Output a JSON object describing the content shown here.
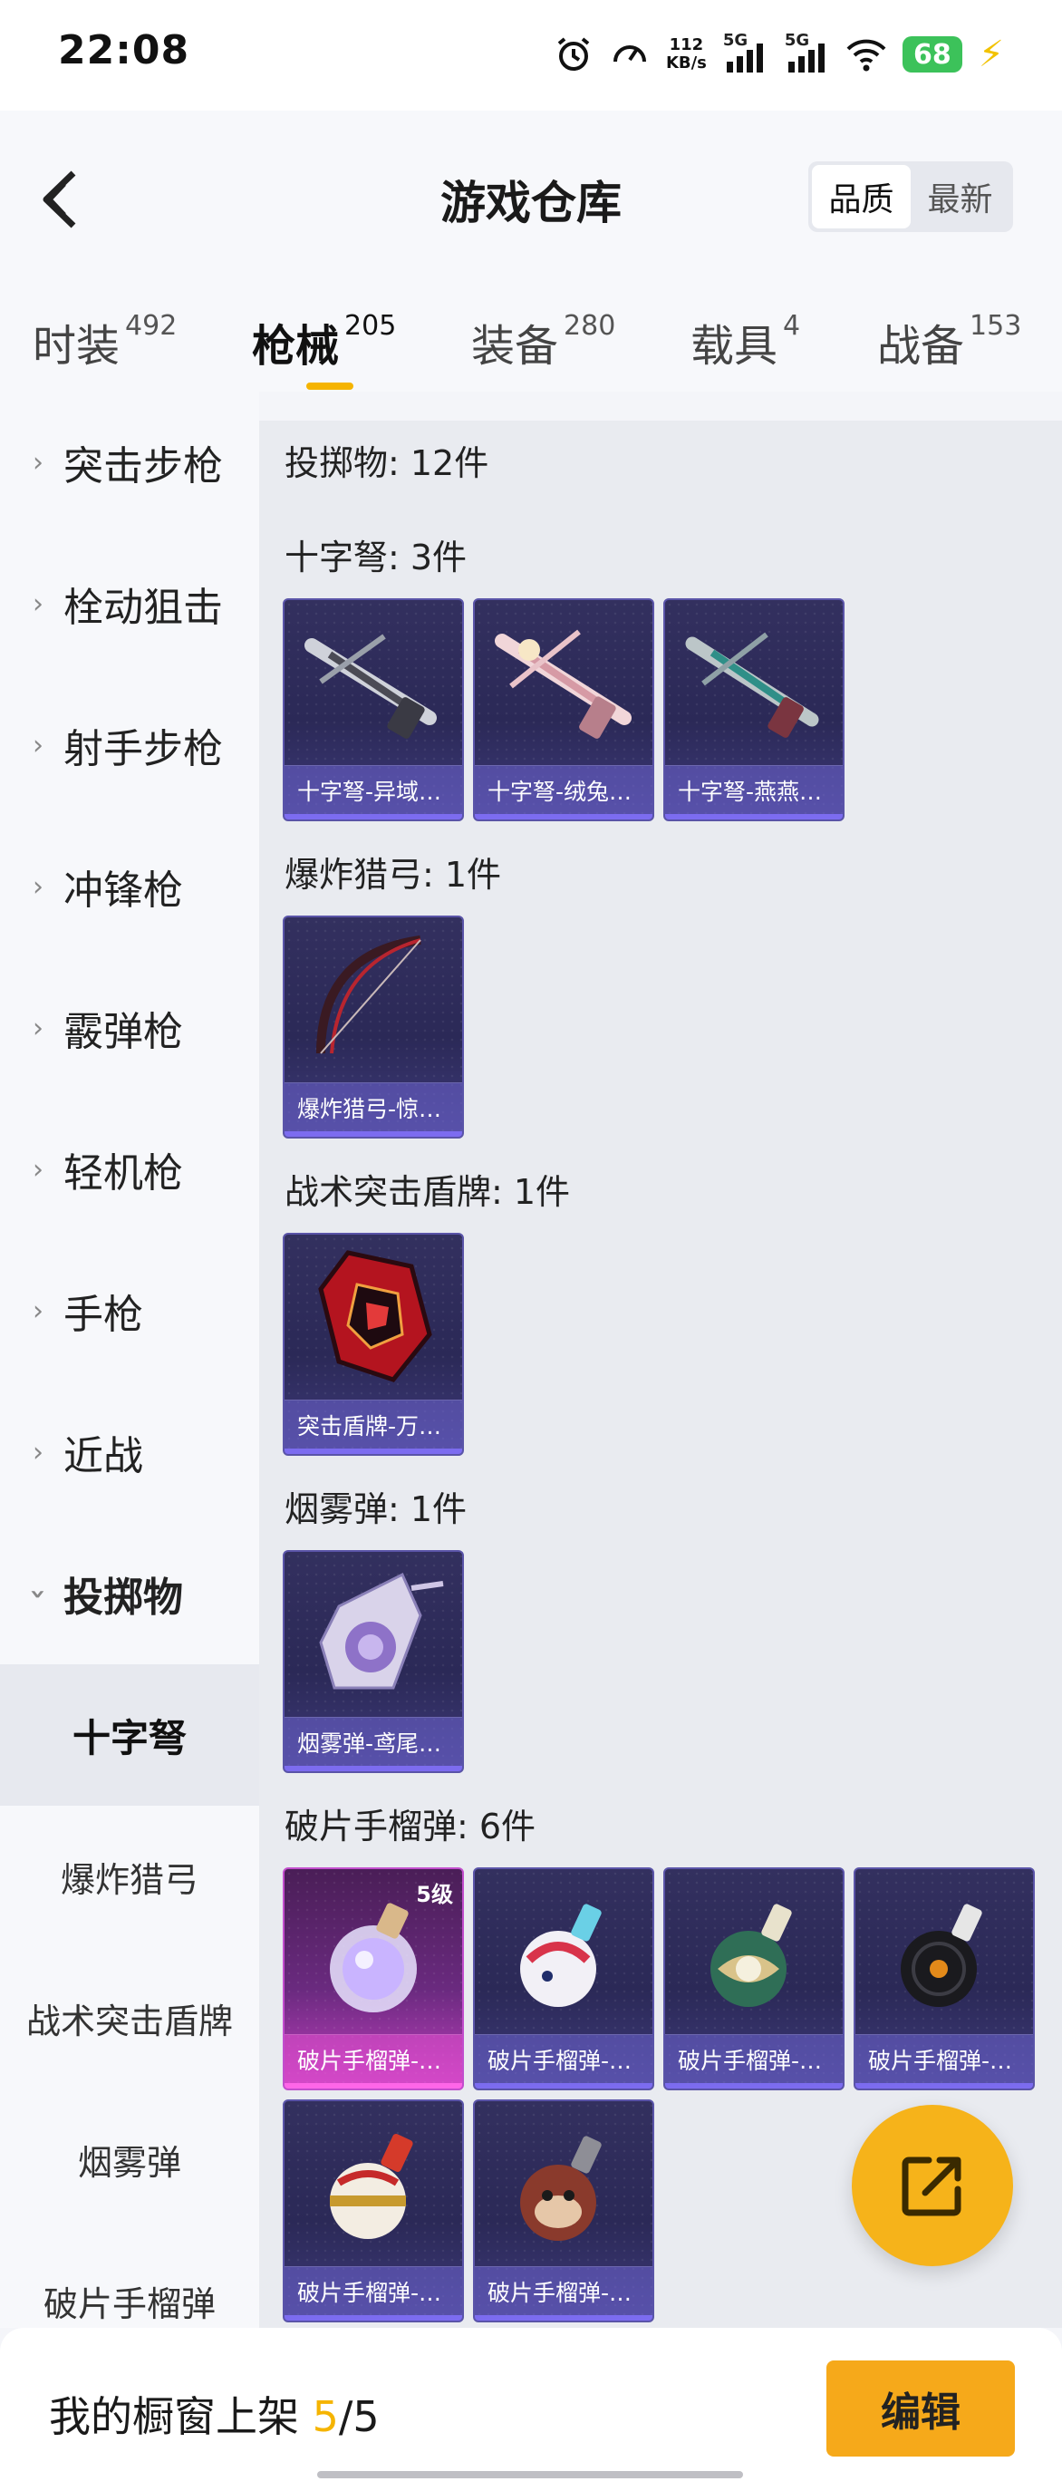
{
  "status_bar": {
    "time": "22:08",
    "net_speed_value": "112",
    "net_speed_unit": "KB/s",
    "signal1_label": "5G",
    "signal2_label": "5G",
    "battery": "68",
    "icons": [
      "alarm-icon",
      "speedometer-icon",
      "signal-icon",
      "wifi-icon",
      "battery-icon",
      "charging-icon"
    ]
  },
  "header": {
    "title": "游戏仓库",
    "sort_options": [
      "品质",
      "最新"
    ],
    "sort_active": "品质"
  },
  "tabs": [
    {
      "label": "时装",
      "count": "492"
    },
    {
      "label": "枪械",
      "count": "205",
      "active": true
    },
    {
      "label": "装备",
      "count": "280"
    },
    {
      "label": "载具",
      "count": "4"
    },
    {
      "label": "战备",
      "count": "153"
    }
  ],
  "sidebar": {
    "categories": [
      "突击步枪",
      "栓动狙击",
      "射手步枪",
      "冲锋枪",
      "霰弹枪",
      "轻机枪",
      "手枪",
      "近战",
      "投掷物"
    ],
    "open_category": "投掷物",
    "subcategories": [
      "十字弩",
      "爆炸猎弓",
      "战术突击盾牌",
      "烟雾弹",
      "破片手榴弹"
    ],
    "selected_subcategory": "十字弩"
  },
  "content": {
    "section_title": "投掷物: 12件",
    "groups": [
      {
        "title": "十字弩: 3件",
        "items": [
          {
            "label": "十字弩-异域…",
            "art": "crossbow-dark"
          },
          {
            "label": "十字弩-绒兔…",
            "art": "crossbow-pink"
          },
          {
            "label": "十字弩-燕燕…",
            "art": "crossbow-teal"
          }
        ]
      },
      {
        "title": "爆炸猎弓: 1件",
        "items": [
          {
            "label": "爆炸猎弓-惊…",
            "art": "bow-red"
          }
        ]
      },
      {
        "title": "战术突击盾牌: 1件",
        "items": [
          {
            "label": "突击盾牌-万…",
            "art": "shield-red"
          }
        ]
      },
      {
        "title": "烟雾弹: 1件",
        "items": [
          {
            "label": "烟雾弹-鸢尾…",
            "art": "smoke-rose"
          }
        ]
      },
      {
        "title": "破片手榴弹: 6件",
        "items": [
          {
            "label": "破片手榴弹-…",
            "art": "grenade-potion",
            "level": "5级",
            "rarity": "pink"
          },
          {
            "label": "破片手榴弹-…",
            "art": "grenade-bunny"
          },
          {
            "label": "破片手榴弹-…",
            "art": "grenade-jade"
          },
          {
            "label": "破片手榴弹-…",
            "art": "grenade-vinyl"
          },
          {
            "label": "破片手榴弹-…",
            "art": "grenade-gold"
          },
          {
            "label": "破片手榴弹-…",
            "art": "grenade-monkey"
          }
        ]
      }
    ]
  },
  "bottom_bar": {
    "showcase_label": "我的橱窗上架",
    "showcase_current": "5",
    "showcase_sep": "/",
    "showcase_total": "5",
    "edit_label": "编辑"
  },
  "colors": {
    "accent": "#f5b400",
    "card_purple": "#2b2957",
    "card_pink": "#c23fbf",
    "edit_button": "#f6a91a"
  }
}
